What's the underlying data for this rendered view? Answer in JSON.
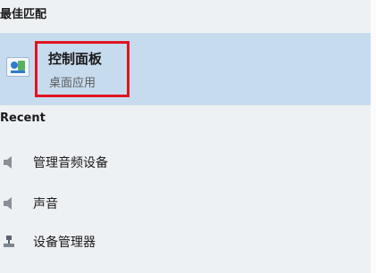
{
  "best_match": {
    "section_label": "最佳匹配",
    "app": {
      "name": "控制面板",
      "type": "桌面应用",
      "icon": "control-panel-icon"
    },
    "highlight_color": "#e0141f",
    "selected_background": "#c7dbef"
  },
  "recent": {
    "label": "Recent",
    "items": [
      {
        "label": "管理音频设备",
        "icon": "speaker-icon"
      },
      {
        "label": "声音",
        "icon": "speaker-icon"
      },
      {
        "label": "设备管理器",
        "icon": "device-manager-icon"
      }
    ]
  }
}
